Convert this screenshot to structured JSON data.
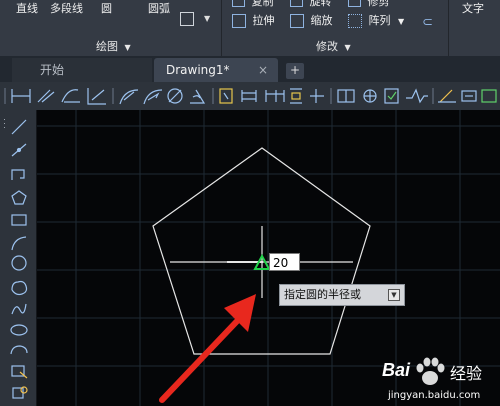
{
  "ribbon": {
    "draw_items": [
      "直线",
      "多段线",
      "圆",
      "圆弧"
    ],
    "draw_panel_title": "绘图",
    "modify_row1": [
      "复制",
      "旋转",
      "修剪"
    ],
    "modify_items": [
      "拉伸",
      "缩放",
      "阵列"
    ],
    "modify_panel_title": "修改",
    "annotate_item": "文字"
  },
  "tabs": {
    "start": "开始",
    "drawing": "Drawing1*",
    "close_symbol": "×",
    "new_symbol": "+"
  },
  "canvas": {
    "input_value": "20",
    "tooltip_text": "指定圆的半径或"
  },
  "watermark": {
    "brand_left": "Bai",
    "brand_right": "经验",
    "site": "jingyan.baidu.com"
  },
  "colors": {
    "canvas_bg": "#050608",
    "geometry": "#e6e6e6",
    "arrow": "#e8281e",
    "snap_marker": "#21d14a"
  }
}
